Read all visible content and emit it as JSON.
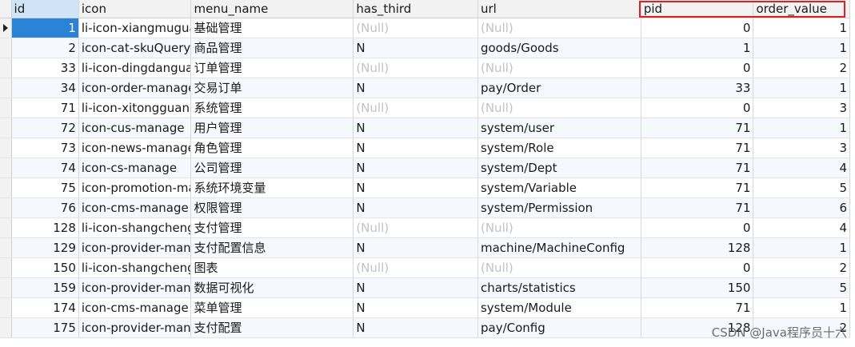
{
  "columns": [
    "id",
    "icon",
    "menu_name",
    "has_third",
    "url",
    "pid",
    "order_value"
  ],
  "rows": [
    {
      "id": "1",
      "icon": "li-icon-xiangmuguanli",
      "menu_name": "基础管理",
      "has_third": "(Null)",
      "url": "(Null)",
      "pid": "0",
      "order_value": "1"
    },
    {
      "id": "2",
      "icon": "icon-cat-skuQuery",
      "menu_name": "商品管理",
      "has_third": "N",
      "url": "goods/Goods",
      "pid": "1",
      "order_value": "1"
    },
    {
      "id": "33",
      "icon": "li-icon-dingdanguanli",
      "menu_name": "订单管理",
      "has_third": "(Null)",
      "url": "(Null)",
      "pid": "0",
      "order_value": "2"
    },
    {
      "id": "34",
      "icon": "icon-order-manage",
      "menu_name": "交易订单",
      "has_third": "N",
      "url": "pay/Order",
      "pid": "33",
      "order_value": "1"
    },
    {
      "id": "71",
      "icon": "li-icon-xitongguanli",
      "menu_name": "系统管理",
      "has_third": "(Null)",
      "url": "(Null)",
      "pid": "0",
      "order_value": "3"
    },
    {
      "id": "72",
      "icon": "icon-cus-manage",
      "menu_name": "用户管理",
      "has_third": "N",
      "url": "system/user",
      "pid": "71",
      "order_value": "1"
    },
    {
      "id": "73",
      "icon": "icon-news-manage",
      "menu_name": "角色管理",
      "has_third": "N",
      "url": "system/Role",
      "pid": "71",
      "order_value": "3"
    },
    {
      "id": "74",
      "icon": "icon-cs-manage",
      "menu_name": "公司管理",
      "has_third": "N",
      "url": "system/Dept",
      "pid": "71",
      "order_value": "4"
    },
    {
      "id": "75",
      "icon": "icon-promotion-manage",
      "menu_name": "系统环境变量",
      "has_third": "N",
      "url": "system/Variable",
      "pid": "71",
      "order_value": "5"
    },
    {
      "id": "76",
      "icon": "icon-cms-manage",
      "menu_name": "权限管理",
      "has_third": "N",
      "url": "system/Permission",
      "pid": "71",
      "order_value": "6"
    },
    {
      "id": "128",
      "icon": "li-icon-shangchengxitong",
      "menu_name": "支付管理",
      "has_third": "(Null)",
      "url": "(Null)",
      "pid": "0",
      "order_value": "4"
    },
    {
      "id": "129",
      "icon": "icon-provider-manage",
      "menu_name": "支付配置信息",
      "has_third": "N",
      "url": "machine/MachineConfig",
      "pid": "128",
      "order_value": "1"
    },
    {
      "id": "150",
      "icon": "li-icon-shangchengxitong",
      "menu_name": "图表",
      "has_third": "(Null)",
      "url": "(Null)",
      "pid": "0",
      "order_value": "2"
    },
    {
      "id": "159",
      "icon": "icon-provider-manage",
      "menu_name": "数据可视化",
      "has_third": "N",
      "url": "charts/statistics",
      "pid": "150",
      "order_value": "5"
    },
    {
      "id": "174",
      "icon": "icon-cms-manage",
      "menu_name": "菜单管理",
      "has_third": "N",
      "url": "system/Module",
      "pid": "71",
      "order_value": "1"
    },
    {
      "id": "175",
      "icon": "icon-provider-manage",
      "menu_name": "支付配置",
      "has_third": "N",
      "url": "pay/Config",
      "pid": "128",
      "order_value": "2"
    }
  ],
  "watermark": "CSDN @Java程序员十六",
  "colors": {
    "selection": "#2a83d6",
    "header": "#f2f2f2",
    "highlight_box": "#e02020",
    "null_text": "#c2c2c2"
  },
  "icons": {
    "current_row_marker": "triangle-right-icon"
  }
}
